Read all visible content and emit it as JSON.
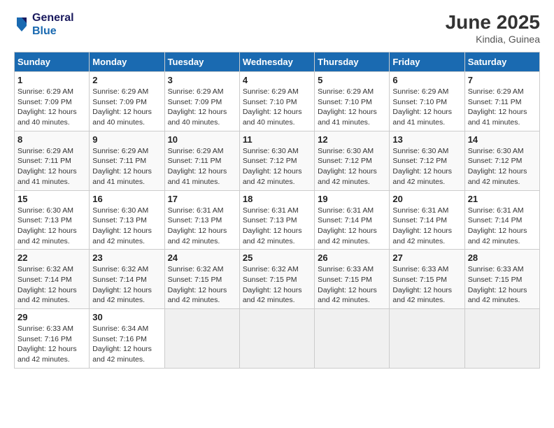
{
  "logo": {
    "line1": "General",
    "line2": "Blue"
  },
  "title": "June 2025",
  "location": "Kindia, Guinea",
  "days_of_week": [
    "Sunday",
    "Monday",
    "Tuesday",
    "Wednesday",
    "Thursday",
    "Friday",
    "Saturday"
  ],
  "weeks": [
    [
      {
        "day": "1",
        "info": "Sunrise: 6:29 AM\nSunset: 7:09 PM\nDaylight: 12 hours\nand 40 minutes."
      },
      {
        "day": "2",
        "info": "Sunrise: 6:29 AM\nSunset: 7:09 PM\nDaylight: 12 hours\nand 40 minutes."
      },
      {
        "day": "3",
        "info": "Sunrise: 6:29 AM\nSunset: 7:09 PM\nDaylight: 12 hours\nand 40 minutes."
      },
      {
        "day": "4",
        "info": "Sunrise: 6:29 AM\nSunset: 7:10 PM\nDaylight: 12 hours\nand 40 minutes."
      },
      {
        "day": "5",
        "info": "Sunrise: 6:29 AM\nSunset: 7:10 PM\nDaylight: 12 hours\nand 41 minutes."
      },
      {
        "day": "6",
        "info": "Sunrise: 6:29 AM\nSunset: 7:10 PM\nDaylight: 12 hours\nand 41 minutes."
      },
      {
        "day": "7",
        "info": "Sunrise: 6:29 AM\nSunset: 7:11 PM\nDaylight: 12 hours\nand 41 minutes."
      }
    ],
    [
      {
        "day": "8",
        "info": "Sunrise: 6:29 AM\nSunset: 7:11 PM\nDaylight: 12 hours\nand 41 minutes."
      },
      {
        "day": "9",
        "info": "Sunrise: 6:29 AM\nSunset: 7:11 PM\nDaylight: 12 hours\nand 41 minutes."
      },
      {
        "day": "10",
        "info": "Sunrise: 6:29 AM\nSunset: 7:11 PM\nDaylight: 12 hours\nand 41 minutes."
      },
      {
        "day": "11",
        "info": "Sunrise: 6:30 AM\nSunset: 7:12 PM\nDaylight: 12 hours\nand 42 minutes."
      },
      {
        "day": "12",
        "info": "Sunrise: 6:30 AM\nSunset: 7:12 PM\nDaylight: 12 hours\nand 42 minutes."
      },
      {
        "day": "13",
        "info": "Sunrise: 6:30 AM\nSunset: 7:12 PM\nDaylight: 12 hours\nand 42 minutes."
      },
      {
        "day": "14",
        "info": "Sunrise: 6:30 AM\nSunset: 7:12 PM\nDaylight: 12 hours\nand 42 minutes."
      }
    ],
    [
      {
        "day": "15",
        "info": "Sunrise: 6:30 AM\nSunset: 7:13 PM\nDaylight: 12 hours\nand 42 minutes."
      },
      {
        "day": "16",
        "info": "Sunrise: 6:30 AM\nSunset: 7:13 PM\nDaylight: 12 hours\nand 42 minutes."
      },
      {
        "day": "17",
        "info": "Sunrise: 6:31 AM\nSunset: 7:13 PM\nDaylight: 12 hours\nand 42 minutes."
      },
      {
        "day": "18",
        "info": "Sunrise: 6:31 AM\nSunset: 7:13 PM\nDaylight: 12 hours\nand 42 minutes."
      },
      {
        "day": "19",
        "info": "Sunrise: 6:31 AM\nSunset: 7:14 PM\nDaylight: 12 hours\nand 42 minutes."
      },
      {
        "day": "20",
        "info": "Sunrise: 6:31 AM\nSunset: 7:14 PM\nDaylight: 12 hours\nand 42 minutes."
      },
      {
        "day": "21",
        "info": "Sunrise: 6:31 AM\nSunset: 7:14 PM\nDaylight: 12 hours\nand 42 minutes."
      }
    ],
    [
      {
        "day": "22",
        "info": "Sunrise: 6:32 AM\nSunset: 7:14 PM\nDaylight: 12 hours\nand 42 minutes."
      },
      {
        "day": "23",
        "info": "Sunrise: 6:32 AM\nSunset: 7:14 PM\nDaylight: 12 hours\nand 42 minutes."
      },
      {
        "day": "24",
        "info": "Sunrise: 6:32 AM\nSunset: 7:15 PM\nDaylight: 12 hours\nand 42 minutes."
      },
      {
        "day": "25",
        "info": "Sunrise: 6:32 AM\nSunset: 7:15 PM\nDaylight: 12 hours\nand 42 minutes."
      },
      {
        "day": "26",
        "info": "Sunrise: 6:33 AM\nSunset: 7:15 PM\nDaylight: 12 hours\nand 42 minutes."
      },
      {
        "day": "27",
        "info": "Sunrise: 6:33 AM\nSunset: 7:15 PM\nDaylight: 12 hours\nand 42 minutes."
      },
      {
        "day": "28",
        "info": "Sunrise: 6:33 AM\nSunset: 7:15 PM\nDaylight: 12 hours\nand 42 minutes."
      }
    ],
    [
      {
        "day": "29",
        "info": "Sunrise: 6:33 AM\nSunset: 7:16 PM\nDaylight: 12 hours\nand 42 minutes."
      },
      {
        "day": "30",
        "info": "Sunrise: 6:34 AM\nSunset: 7:16 PM\nDaylight: 12 hours\nand 42 minutes."
      },
      {
        "day": "",
        "info": ""
      },
      {
        "day": "",
        "info": ""
      },
      {
        "day": "",
        "info": ""
      },
      {
        "day": "",
        "info": ""
      },
      {
        "day": "",
        "info": ""
      }
    ]
  ]
}
